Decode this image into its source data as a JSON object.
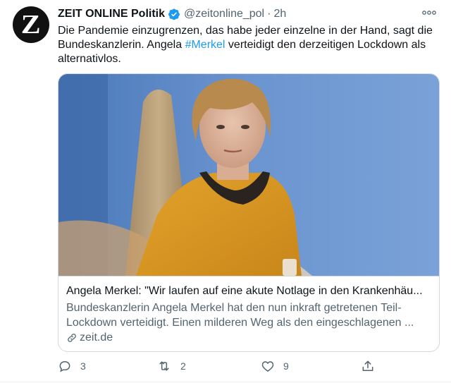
{
  "tweet": {
    "author_name": "ZEIT ONLINE Politik",
    "handle": "@zeitonline_pol",
    "separator": "·",
    "time": "2h",
    "avatar_letter": "Z",
    "text_part1": "Die Pandemie einzugrenzen, das habe jeder einzelne in der Hand, sagt die Bundeskanzlerin. Angela ",
    "hashtag": "#Merkel",
    "text_part2": " verteidigt den derzeitigen Lockdown als alternativlos."
  },
  "card": {
    "title": "Angela Merkel: \"Wir laufen auf eine akute Notlage in den Krankenhäu...",
    "description": "Bundeskanzlerin Angela Merkel hat den nun inkraft getretenen Teil-Lockdown verteidigt. Einen milderen Weg als den eingeschlagenen ...",
    "domain": "zeit.de"
  },
  "actions": {
    "reply_count": "3",
    "retweet_count": "2",
    "like_count": "9"
  },
  "colors": {
    "accent": "#1d9bf0",
    "secondary_text": "#536471",
    "border": "#cfd9de"
  },
  "icons": [
    "verified-badge-icon",
    "more-icon",
    "link-icon",
    "reply-icon",
    "retweet-icon",
    "like-icon",
    "share-icon"
  ]
}
